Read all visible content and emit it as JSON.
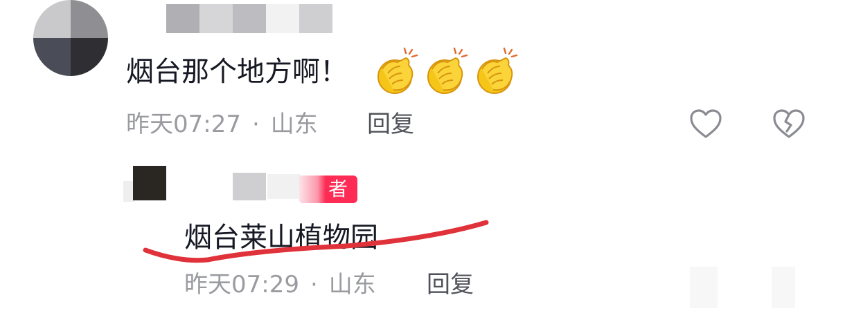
{
  "comments": [
    {
      "text": "烟台那个地方啊！",
      "emoji_icon": "clapping-hands-icon",
      "emoji_count": 3,
      "time": "昨天07:27",
      "separator": "·",
      "location": "山东",
      "reply_label": "回复"
    },
    {
      "badge": "者",
      "text": "烟台莱山植物园",
      "time": "昨天07:29",
      "separator": "·",
      "location": "山东",
      "reply_label": "回复"
    }
  ],
  "icons": {
    "like": "heart-outline-icon",
    "dislike": "broken-heart-icon"
  },
  "colors": {
    "badge": "#fe2c55",
    "annotation_underline": "#e0323a",
    "meta_text": "#9a9ba0"
  }
}
